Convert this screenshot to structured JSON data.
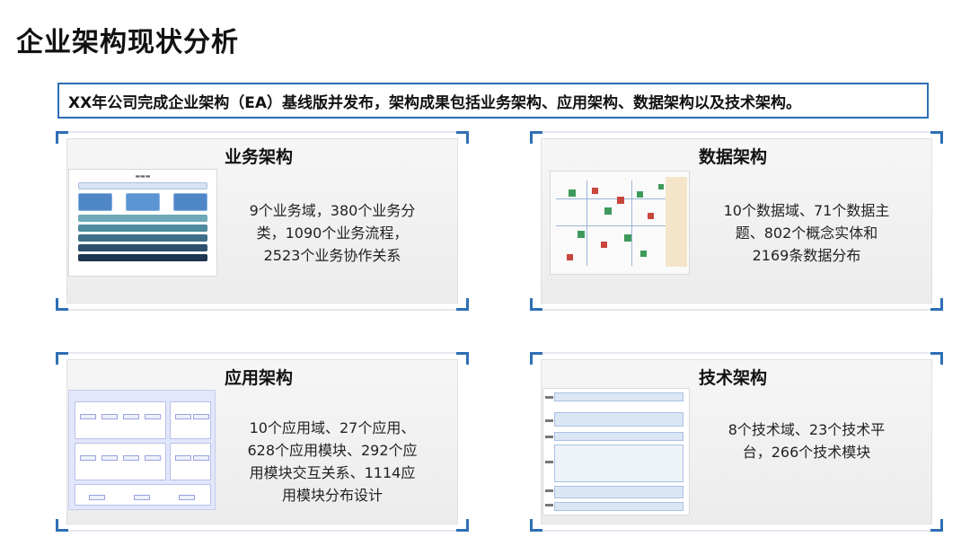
{
  "title": "企业架构现状分析",
  "summary": "XX年公司完成企业架构（EA）基线版并发布，架构成果包括业务架构、应用架构、数据架构以及技术架构。",
  "cards": [
    {
      "title": "业务架构",
      "lines": [
        "9个业务域，380个业务分",
        "类，1090个业务流程，",
        "2523个业务协作关系"
      ]
    },
    {
      "title": "数据架构",
      "lines": [
        "10个数据域、71个数据主",
        "题、802个概念实体和",
        "2169条数据分布"
      ]
    },
    {
      "title": "应用架构",
      "lines": [
        "10个应用域、27个应用、",
        "628个应用模块、292个应",
        "用模块交互关系、1114应",
        "用模块分布设计"
      ]
    },
    {
      "title": "技术架构",
      "lines": [
        "8个技术域、23个技术平",
        "台，266个技术模块"
      ]
    }
  ],
  "colors": {
    "accent": "#2f6fb5",
    "text": "#111111"
  }
}
